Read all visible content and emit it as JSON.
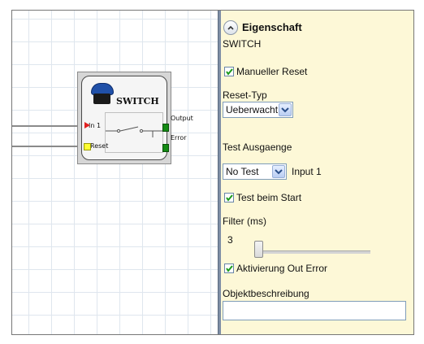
{
  "block": {
    "title": "SWITCH",
    "input1_label": "In 1",
    "reset_label": "Reset",
    "output_label": "Output",
    "error_label": "Error"
  },
  "panel": {
    "header": "Eigenschaft",
    "subheader": "SWITCH",
    "manual_reset": {
      "label": "Manueller Reset",
      "checked": true
    },
    "reset_type": {
      "label": "Reset-Typ",
      "value": "Ueberwacht"
    },
    "test_outputs": {
      "label": "Test Ausgaenge",
      "value": "No Test",
      "suffix": "Input 1"
    },
    "test_on_start": {
      "label": "Test beim Start",
      "checked": true
    },
    "filter": {
      "label": "Filter (ms)",
      "value": "3",
      "level": 0
    },
    "activate_out_error": {
      "label": "Aktivierung Out Error",
      "checked": true
    },
    "object_description": {
      "label": "Objektbeschreibung",
      "value": ""
    }
  },
  "colors": {
    "panel_bg": "#fdf8d7",
    "output_port": "#138a13",
    "input_marker": "#e02020",
    "reset_port": "#ffff33",
    "button_cap": "#2050a8"
  }
}
